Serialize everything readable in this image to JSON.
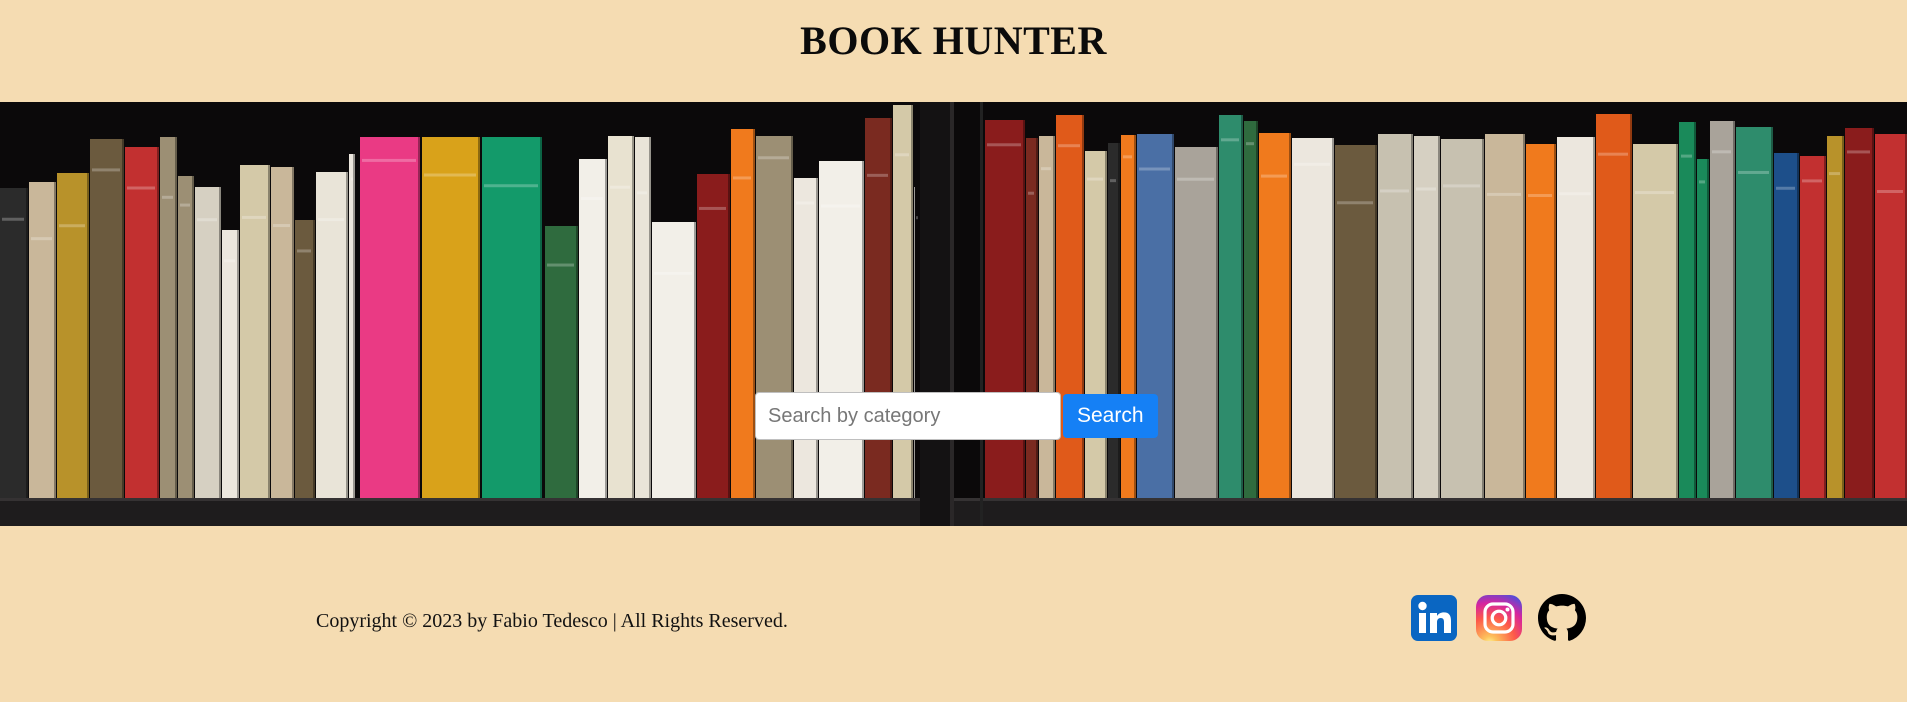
{
  "header": {
    "title": "BOOK HUNTER"
  },
  "search": {
    "placeholder": "Search by category",
    "value": "",
    "button_label": "Search"
  },
  "footer": {
    "copyright": "Copyright © 2023 by Fabio Tedesco | All Rights Reserved."
  },
  "social": [
    {
      "name": "linkedin-icon",
      "label": "in",
      "color": "#0a66c2"
    },
    {
      "name": "instagram-icon",
      "color": "#d6249f"
    },
    {
      "name": "github-icon",
      "color": "#000000"
    }
  ],
  "hero": {
    "image": "bookshelf-photo"
  }
}
